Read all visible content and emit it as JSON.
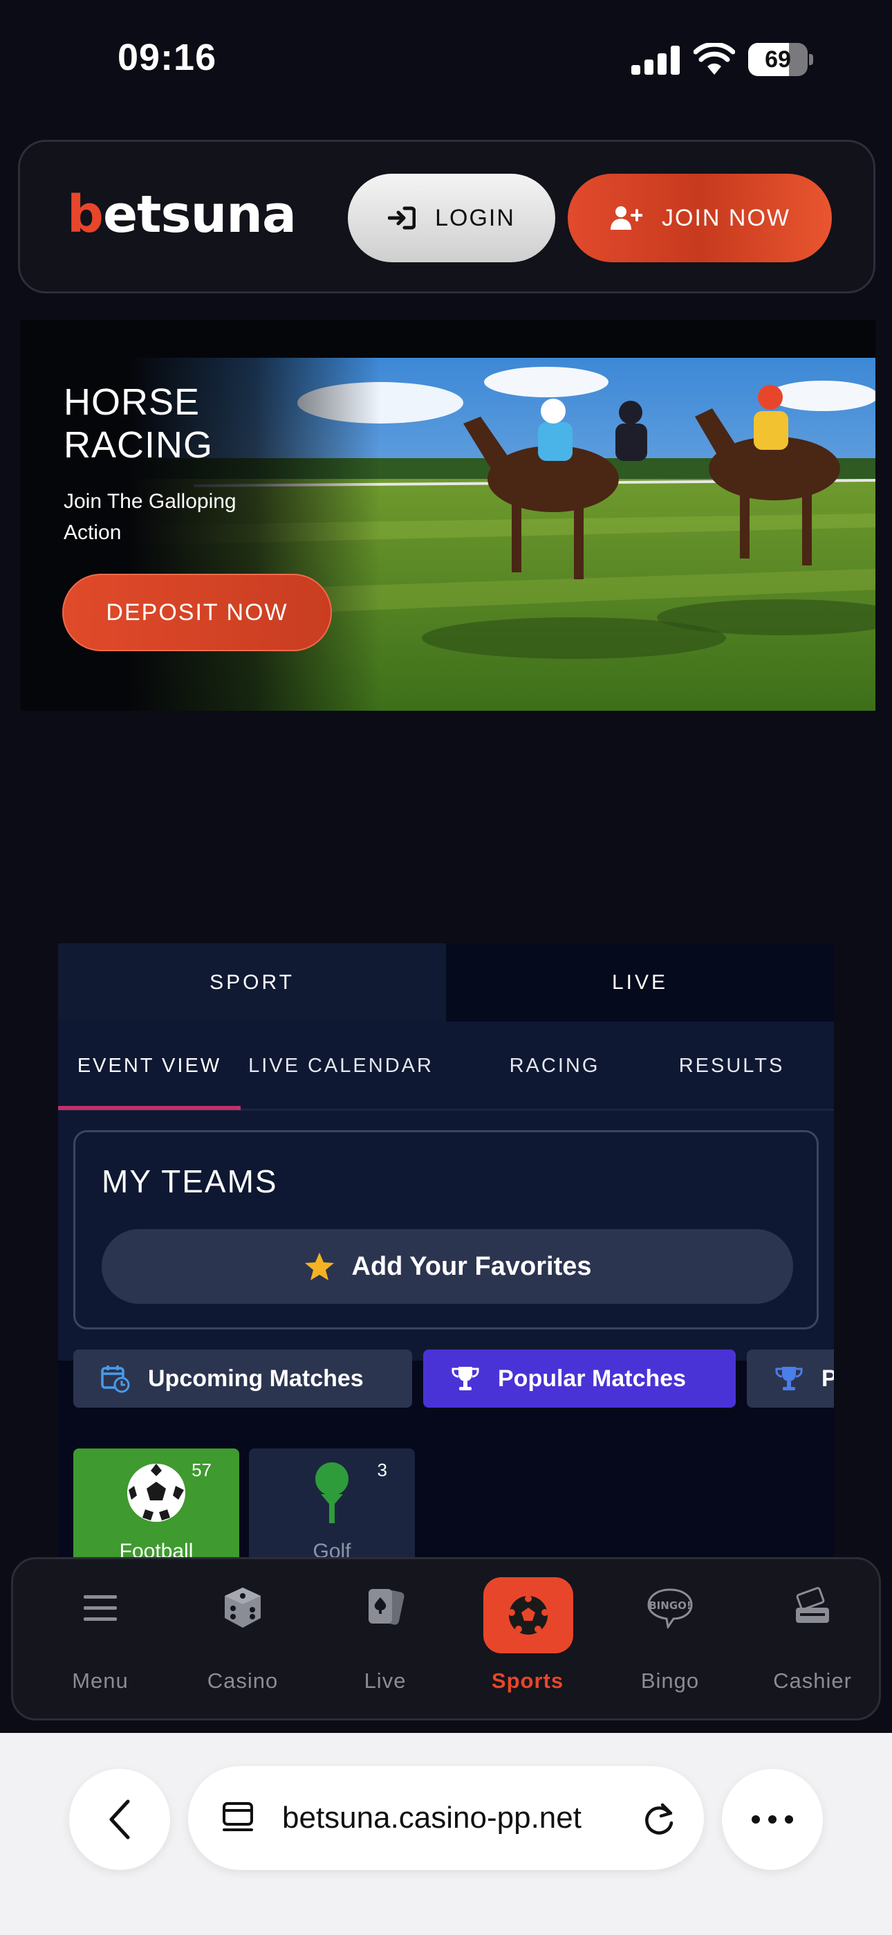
{
  "status_bar": {
    "time": "09:16",
    "battery": "69",
    "battery_level": 0.69
  },
  "header": {
    "logo": "betsuna",
    "login_label": "LOGIN",
    "join_label": "JOIN NOW"
  },
  "hero": {
    "title": "HORSE RACING",
    "subtitle": "Join The Galloping Action",
    "cta": "DEPOSIT NOW"
  },
  "sports": {
    "main_tabs": [
      {
        "label": "SPORT"
      },
      {
        "label": "LIVE"
      }
    ],
    "sub_tabs": [
      {
        "label": "EVENT VIEW"
      },
      {
        "label": "LIVE CALENDAR"
      },
      {
        "label": "RACING"
      },
      {
        "label": "RESULTS"
      }
    ],
    "my_teams": {
      "title": "MY TEAMS",
      "add_favorites": "Add Your Favorites"
    },
    "chips": [
      {
        "label": "Upcoming Matches"
      },
      {
        "label": "Popular Matches"
      },
      {
        "label": "P"
      }
    ],
    "tiles": [
      {
        "label": "Football",
        "count": "57"
      },
      {
        "label": "Golf",
        "count": "3"
      }
    ]
  },
  "bottom_nav": [
    {
      "label": "Menu"
    },
    {
      "label": "Casino"
    },
    {
      "label": "Live"
    },
    {
      "label": "Sports"
    },
    {
      "label": "Bingo",
      "icon_text": "BINGO!"
    },
    {
      "label": "Cashier"
    }
  ],
  "browser": {
    "url": "betsuna.casino-pp.net"
  },
  "colors": {
    "accent": "#e8462a",
    "popular": "#4a33d6",
    "football": "#3f9a2f"
  }
}
